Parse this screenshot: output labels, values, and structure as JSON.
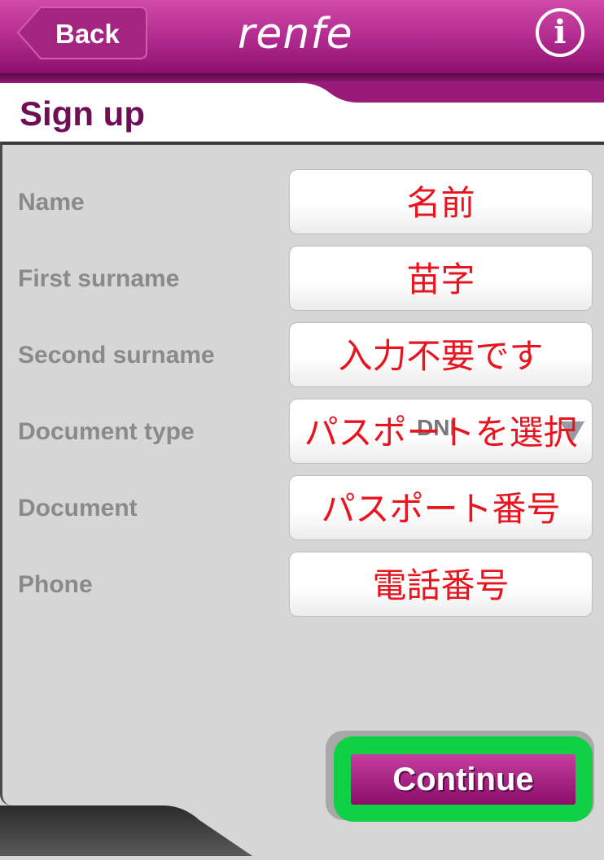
{
  "header": {
    "back_label": "Back",
    "logo": "renfe",
    "info_icon": "info-icon"
  },
  "page": {
    "title": "Sign up"
  },
  "form": {
    "rows": [
      {
        "label": "Name",
        "annotation": "名前"
      },
      {
        "label": "First surname",
        "annotation": "苗字"
      },
      {
        "label": "Second surname",
        "annotation": "入力不要です"
      },
      {
        "label": "Document type",
        "value": "DNI",
        "annotation": "パスポートを選択"
      },
      {
        "label": "Document",
        "annotation": "パスポート番号"
      },
      {
        "label": "Phone",
        "annotation": "電話番号"
      }
    ]
  },
  "actions": {
    "continue_label": "Continue"
  },
  "colors": {
    "brand": "#b02a8e",
    "title": "#6e0f55",
    "annotation": "#e8141e",
    "highlight": "#10d046"
  }
}
